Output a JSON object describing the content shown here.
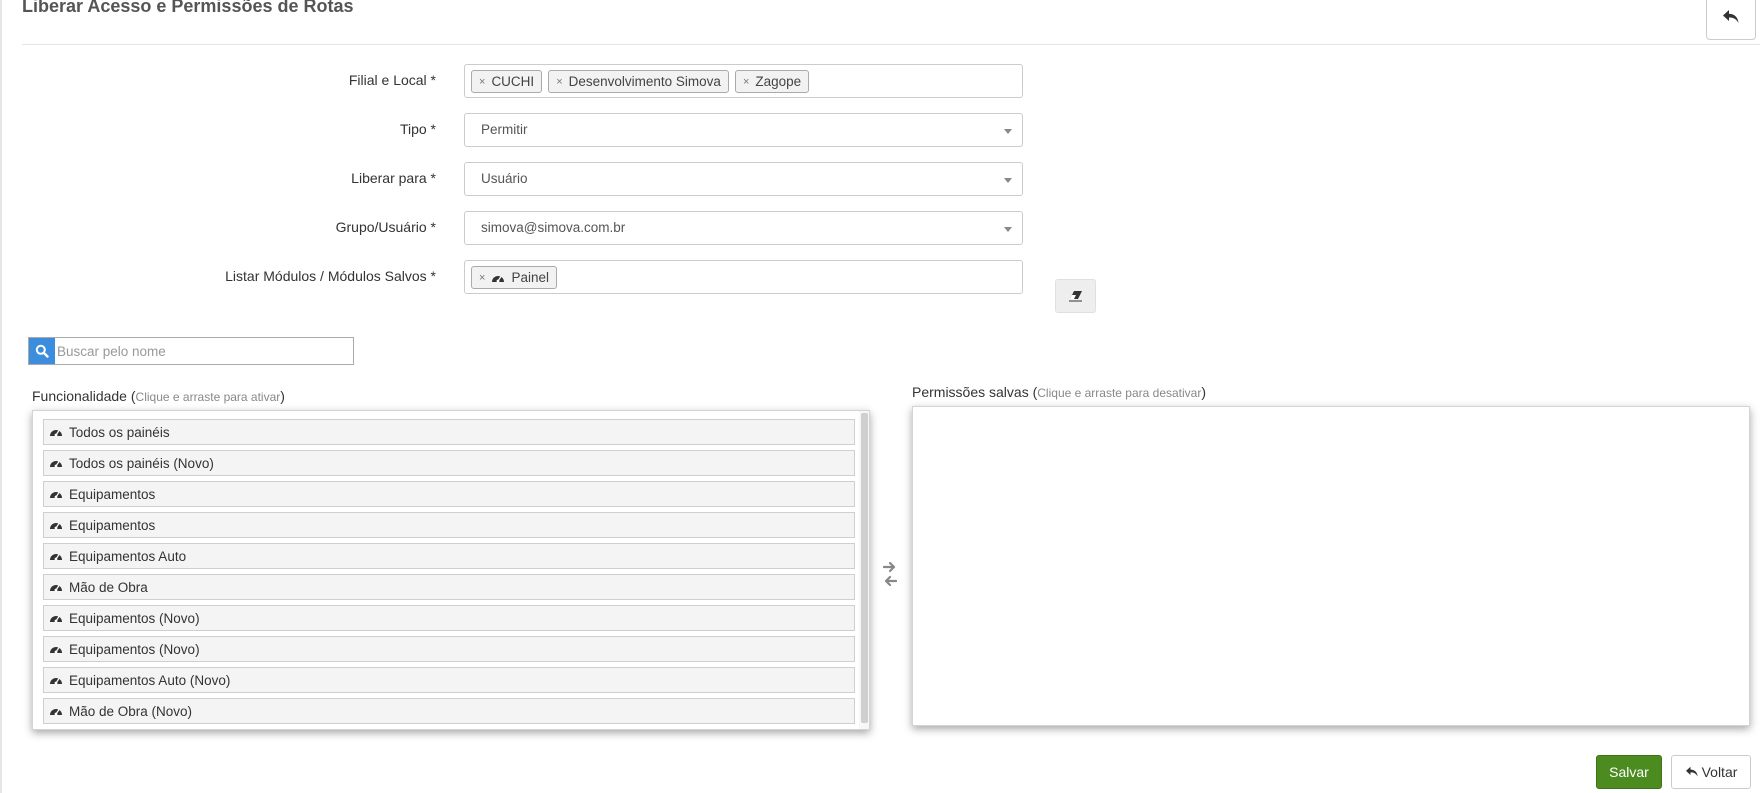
{
  "page": {
    "title": "Liberar Acesso e Permissões de Rotas"
  },
  "form": {
    "filial": {
      "label": "Filial e Local *",
      "tags": [
        "CUCHI",
        "Desenvolvimento Simova",
        "Zagope"
      ]
    },
    "tipo": {
      "label": "Tipo *",
      "value": "Permitir"
    },
    "liberar": {
      "label": "Liberar para *",
      "value": "Usuário"
    },
    "grupo": {
      "label": "Grupo/Usuário *",
      "value": "simova@simova.com.br"
    },
    "modulos": {
      "label": "Listar Módulos / Módulos Salvos *",
      "tags": [
        "Painel"
      ]
    }
  },
  "search": {
    "placeholder": "Buscar pelo nome"
  },
  "funcionalidade": {
    "title": "Funcionalidade",
    "hint": "Clique e arraste para ativar",
    "items": [
      "Todos os painéis",
      "Todos os painéis (Novo)",
      "Equipamentos",
      "Equipamentos",
      "Equipamentos Auto",
      "Mão de Obra",
      "Equipamentos (Novo)",
      "Equipamentos (Novo)",
      "Equipamentos Auto (Novo)",
      "Mão de Obra (Novo)"
    ]
  },
  "saved": {
    "title": "Permissões salvas",
    "hint": "Clique e arraste para desativar"
  },
  "actions": {
    "save_label": "Salvar",
    "back_label": "Voltar"
  },
  "icons": {
    "item_icon": "dashboard-icon",
    "search": "search-icon",
    "eraser": "eraser-icon",
    "back": "reply-icon"
  },
  "colors": {
    "primary": "#3c8dde",
    "success": "#4b8b1f"
  }
}
